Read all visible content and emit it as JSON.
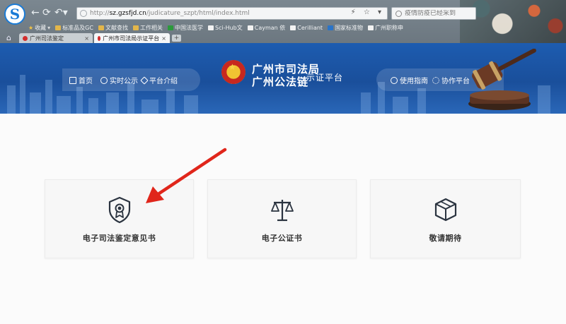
{
  "browser": {
    "logo_letter": "S",
    "address": {
      "protocol": "http://",
      "host": "sz.gzsfjd.cn",
      "path": "/judicature_szpt/html/index.html",
      "tools": "⚡ ☆ ▾"
    },
    "search": {
      "placeholder": "疫情防疫已经采到"
    },
    "bookmarks": [
      {
        "label": "收藏",
        "icon": "star-icon"
      },
      {
        "label": "标准品及GC",
        "icon": "folder-icon"
      },
      {
        "label": "文献查找",
        "icon": "folder-icon"
      },
      {
        "label": "工作相关",
        "icon": "folder-icon"
      },
      {
        "label": "中国法医学",
        "icon": "green-icon"
      },
      {
        "label": "Sci-Hub文",
        "icon": "doc-icon"
      },
      {
        "label": "Cayman 依",
        "icon": "doc-icon"
      },
      {
        "label": "Cerilliant",
        "icon": "doc-icon"
      },
      {
        "label": "国家标准物",
        "icon": "blue-icon"
      },
      {
        "label": "广州职称申",
        "icon": "doc-icon"
      }
    ],
    "tabs": [
      {
        "label": "广州司法鉴定",
        "close": "×"
      },
      {
        "label": "广州市司法局示证平台",
        "close": "×"
      }
    ],
    "new_tab": "+"
  },
  "site": {
    "nav_left": [
      {
        "label": "首页",
        "icon": "home-icon"
      },
      {
        "label": "实时公示",
        "icon": "clock-icon"
      },
      {
        "label": "平台介绍",
        "icon": "layers-icon"
      }
    ],
    "title_line1": "广州市司法局",
    "title_line2": "广州公法链",
    "subtitle": "示证平台",
    "nav_right": [
      {
        "label": "使用指南",
        "icon": "compass-icon"
      },
      {
        "label": "协作平台",
        "icon": "share-icon"
      }
    ]
  },
  "cards": [
    {
      "label": "电子司法鉴定意见书",
      "icon": "shield-badge-icon"
    },
    {
      "label": "电子公证书",
      "icon": "scales-icon"
    },
    {
      "label": "敬请期待",
      "icon": "box-icon"
    }
  ],
  "colors": {
    "header_blue": "#1d5cb0",
    "arrow_red": "#e0261b",
    "card_bg": "#f7f7f7",
    "icon_dark": "#2b3440"
  }
}
